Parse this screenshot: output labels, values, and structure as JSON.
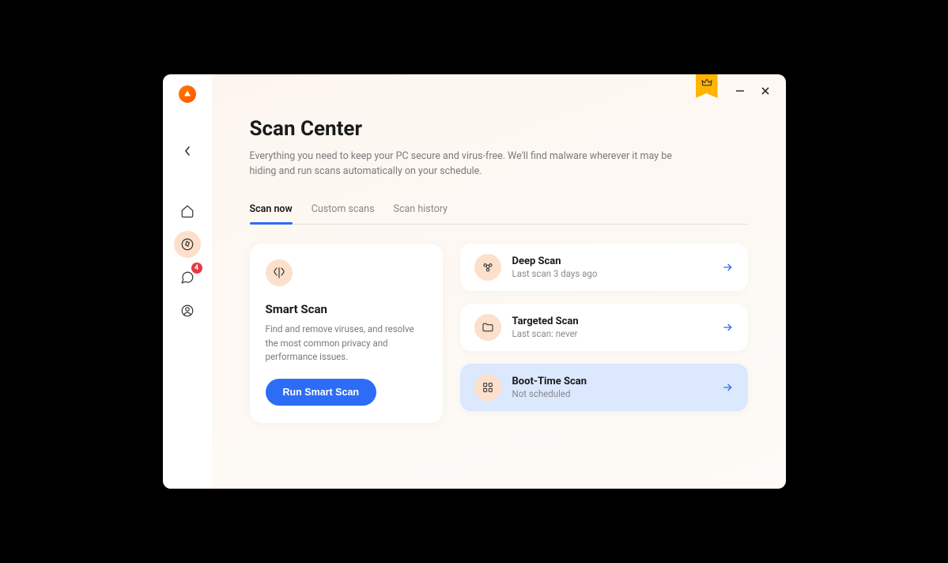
{
  "sidebar": {
    "notification_badge": "4"
  },
  "header": {
    "title": "Scan Center",
    "subtitle": "Everything you need to keep your PC secure and virus-free. We'll find malware wherever it may be hiding and run scans automatically on your schedule."
  },
  "tabs": [
    {
      "label": "Scan now",
      "active": true
    },
    {
      "label": "Custom scans",
      "active": false
    },
    {
      "label": "Scan history",
      "active": false
    }
  ],
  "smart_scan": {
    "title": "Smart Scan",
    "description": "Find and remove viruses, and resolve the most common privacy and performance issues.",
    "button": "Run Smart Scan"
  },
  "scans": [
    {
      "title": "Deep Scan",
      "subtitle": "Last scan 3 days ago",
      "icon": "brain",
      "highlighted": false
    },
    {
      "title": "Targeted Scan",
      "subtitle": "Last scan: never",
      "icon": "folder",
      "highlighted": false
    },
    {
      "title": "Boot-Time Scan",
      "subtitle": "Not scheduled",
      "icon": "grid",
      "highlighted": true
    }
  ]
}
